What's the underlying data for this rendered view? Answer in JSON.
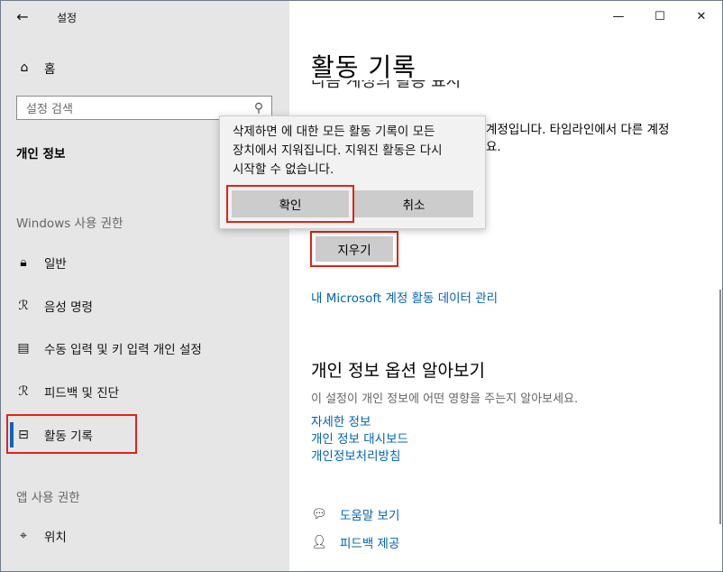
{
  "app": {
    "title": "설정"
  },
  "window_controls": {
    "minimize": "—",
    "maximize": "☐",
    "close": "✕"
  },
  "sidebar": {
    "home_label": "홈",
    "search_placeholder": "설정 검색",
    "section_main": "개인 정보",
    "section_windows": "Windows 사용 권한",
    "items": [
      {
        "label": "일반",
        "icon": "lock-icon"
      },
      {
        "label": "음성 명령",
        "icon": "voice-icon"
      },
      {
        "label": "수동 입력 및 키 입력 개인 설정",
        "icon": "inking-icon"
      },
      {
        "label": "피드백 및 진단",
        "icon": "feedback-icon"
      },
      {
        "label": "활동 기록",
        "icon": "activity-icon",
        "selected": true
      }
    ],
    "section_apps": "앱 사용 권한",
    "app_items": [
      {
        "label": "위치",
        "icon": "location-icon"
      }
    ]
  },
  "main": {
    "title": "활동 기록",
    "cut_heading": "다음 계정의 활동 표시",
    "desc_line1": "계정입니다. 타임라인에서 다른 계정",
    "desc_line2": "요.",
    "clear_button": "지우기",
    "ms_link": "내 Microsoft 계정 활동 데이터 관리",
    "privacy": {
      "title": "개인 정보 옵션 알아보기",
      "desc": "이 설정이 개인 정보에 어떤 영향을 주는지 알아보세요.",
      "links": [
        "자세한 정보",
        "개인 정보 대시보드",
        "개인정보처리방침"
      ]
    },
    "help": {
      "help_label": "도움말 보기",
      "feedback_label": "피드백 제공"
    }
  },
  "dialog": {
    "message_line1": "삭제하면 에 대한 모든 활동 기록이 모든",
    "message_line2": "장치에서 지워집니다. 지워진 활동은 다시",
    "message_line3": "시작할 수 없습니다.",
    "ok": "확인",
    "cancel": "취소"
  },
  "colors": {
    "accent": "#0067c0",
    "link": "#0063b1",
    "highlight": "#e0231a",
    "sidebar_bg": "#e6e6e6",
    "button_bg": "#cccccc"
  }
}
